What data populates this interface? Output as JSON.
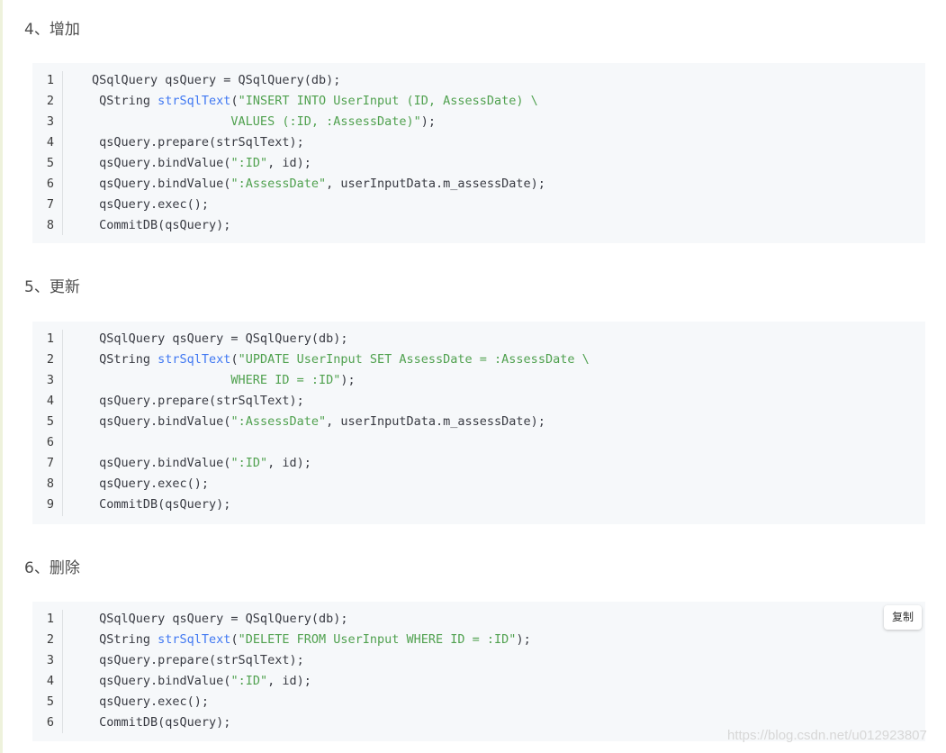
{
  "sections": [
    {
      "heading": "4、增加",
      "lines": [
        [
          {
            "t": "QSqlQuery qsQuery = QSqlQuery(db);",
            "c": ""
          }
        ],
        [
          {
            "t": " QString ",
            "c": ""
          },
          {
            "t": "strSqlText",
            "c": "title"
          },
          {
            "t": "(",
            "c": ""
          },
          {
            "t": "\"INSERT INTO UserInput (ID, AssessDate) \\",
            "c": "string"
          }
        ],
        [
          {
            "t": "                   VALUES (:ID, :AssessDate)\"",
            "c": "string"
          },
          {
            "t": ");",
            "c": ""
          }
        ],
        [
          {
            "t": " qsQuery.prepare(strSqlText);",
            "c": ""
          }
        ],
        [
          {
            "t": " qsQuery.bindValue(",
            "c": ""
          },
          {
            "t": "\":ID\"",
            "c": "string"
          },
          {
            "t": ", id);",
            "c": ""
          }
        ],
        [
          {
            "t": " qsQuery.bindValue(",
            "c": ""
          },
          {
            "t": "\":AssessDate\"",
            "c": "string"
          },
          {
            "t": ", userInputData.m_assessDate);",
            "c": ""
          }
        ],
        [
          {
            "t": " qsQuery.exec();",
            "c": ""
          }
        ],
        [
          {
            "t": " CommitDB(qsQuery);",
            "c": ""
          }
        ]
      ],
      "line_numbers": [
        "1",
        "2",
        "3",
        "4",
        "5",
        "6",
        "7",
        "8"
      ]
    },
    {
      "heading": "5、更新",
      "lines": [
        [
          {
            "t": " QSqlQuery qsQuery = QSqlQuery(db);",
            "c": ""
          }
        ],
        [
          {
            "t": " QString ",
            "c": ""
          },
          {
            "t": "strSqlText",
            "c": "title"
          },
          {
            "t": "(",
            "c": ""
          },
          {
            "t": "\"UPDATE UserInput SET AssessDate = :AssessDate \\",
            "c": "string"
          }
        ],
        [
          {
            "t": "                   WHERE ID = :ID\"",
            "c": "string"
          },
          {
            "t": ");",
            "c": ""
          }
        ],
        [
          {
            "t": " qsQuery.prepare(strSqlText);",
            "c": ""
          }
        ],
        [
          {
            "t": " qsQuery.bindValue(",
            "c": ""
          },
          {
            "t": "\":AssessDate\"",
            "c": "string"
          },
          {
            "t": ", userInputData.m_assessDate);",
            "c": ""
          }
        ],
        [
          {
            "t": "",
            "c": ""
          }
        ],
        [
          {
            "t": " qsQuery.bindValue(",
            "c": ""
          },
          {
            "t": "\":ID\"",
            "c": "string"
          },
          {
            "t": ", id);",
            "c": ""
          }
        ],
        [
          {
            "t": " qsQuery.exec();",
            "c": ""
          }
        ],
        [
          {
            "t": " CommitDB(qsQuery);",
            "c": ""
          }
        ]
      ],
      "line_numbers": [
        "1",
        "2",
        "3",
        "4",
        "5",
        "6",
        "7",
        "8",
        "9"
      ]
    },
    {
      "heading": "6、删除",
      "copy_label": "复制",
      "lines": [
        [
          {
            "t": " QSqlQuery qsQuery = QSqlQuery(db);",
            "c": ""
          }
        ],
        [
          {
            "t": " QString ",
            "c": ""
          },
          {
            "t": "strSqlText",
            "c": "title"
          },
          {
            "t": "(",
            "c": ""
          },
          {
            "t": "\"DELETE FROM UserInput WHERE ID = :ID\"",
            "c": "string"
          },
          {
            "t": ");",
            "c": ""
          }
        ],
        [
          {
            "t": " qsQuery.prepare(strSqlText);",
            "c": ""
          }
        ],
        [
          {
            "t": " qsQuery.bindValue(",
            "c": ""
          },
          {
            "t": "\":ID\"",
            "c": "string"
          },
          {
            "t": ", id);",
            "c": ""
          }
        ],
        [
          {
            "t": " qsQuery.exec();",
            "c": ""
          }
        ],
        [
          {
            "t": " CommitDB(qsQuery);",
            "c": ""
          }
        ]
      ],
      "line_numbers": [
        "1",
        "2",
        "3",
        "4",
        "5",
        "6"
      ]
    }
  ],
  "watermark": "https://blog.csdn.net/u012923807",
  "colors": {
    "code_bg": "#f6f8fa",
    "identifier": "#4078f2",
    "string": "#50a14f",
    "default_code": "#383a42"
  }
}
